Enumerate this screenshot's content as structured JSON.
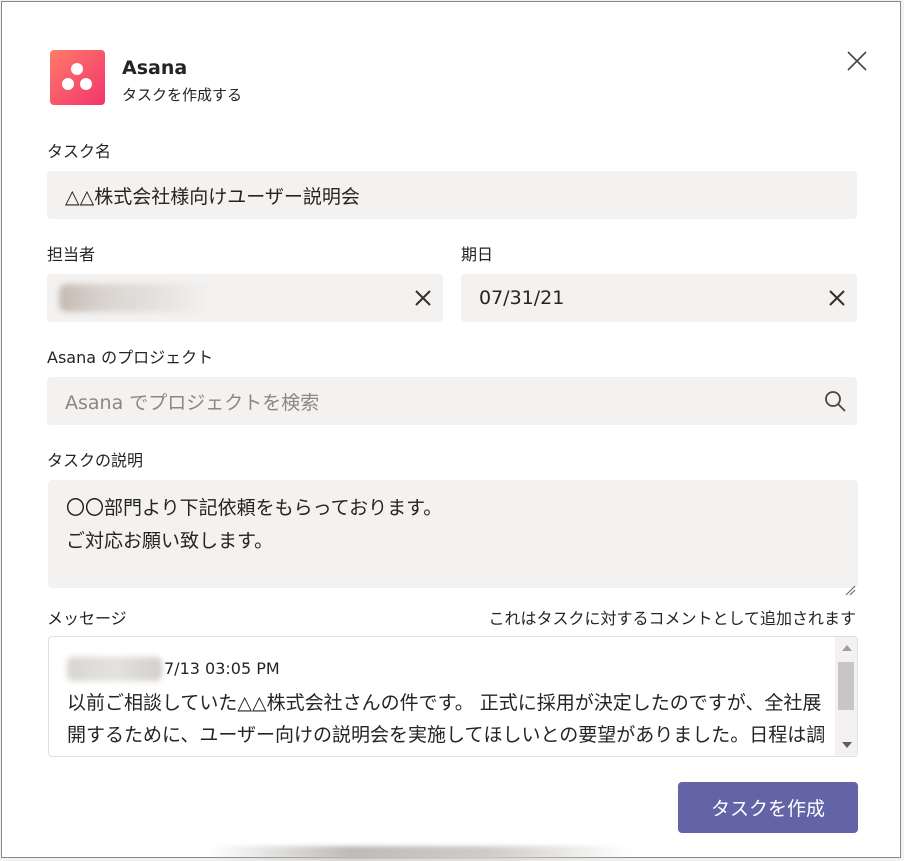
{
  "header": {
    "app_name": "Asana",
    "subtitle": "タスクを作成する",
    "icon": "asana-logo-icon",
    "brand_gradient": [
      "#ff7b6b",
      "#f2346b"
    ]
  },
  "form": {
    "task_name_label": "タスク名",
    "task_name_value": "△△株式会社様向けユーザー説明会",
    "assignee_label": "担当者",
    "due_date_label": "期日",
    "due_date_value": "07/31/21",
    "project_label": "Asana のプロジェクト",
    "project_placeholder": "Asana でプロジェクトを検索",
    "description_label": "タスクの説明",
    "description_lines": [
      "〇〇部門より下記依頼をもらっております。",
      "ご対応お願い致します。"
    ],
    "message_label": "メッセージ",
    "message_hint": "これはタスクに対するコメントとして追加されます"
  },
  "message": {
    "timestamp": "7/13 03:05 PM",
    "body": "以前ご相談していた△△株式会社さんの件です。 正式に採用が決定したのですが、全社展開するために、ユーザー向けの説明会を実施してほしいとの要望がありました。日程は調整中ですが、来月中を予定しています。"
  },
  "actions": {
    "create_label": "タスクを作成"
  },
  "colors": {
    "primary_button": "#6264a7",
    "field_background": "#f3f2f1"
  }
}
